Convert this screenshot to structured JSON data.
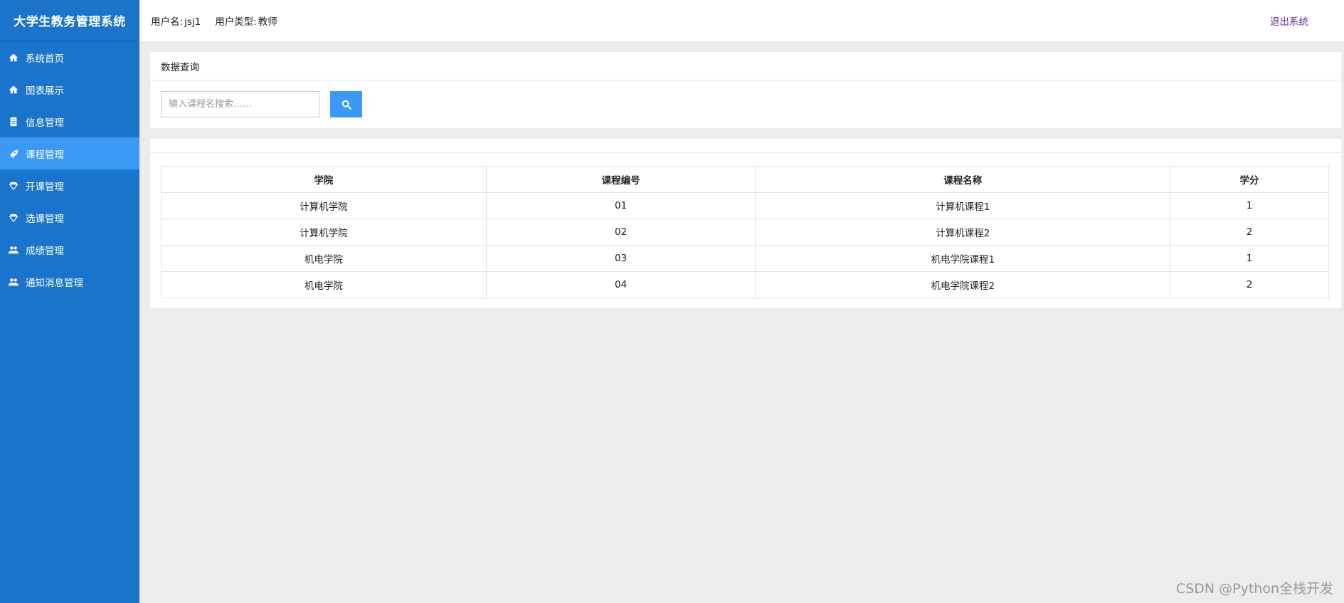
{
  "app": {
    "title": "大学生教务管理系统"
  },
  "sidebar": {
    "items": [
      {
        "label": "系统首页",
        "icon": "home-icon"
      },
      {
        "label": "图表展示",
        "icon": "home-icon"
      },
      {
        "label": "信息管理",
        "icon": "document-icon"
      },
      {
        "label": "课程管理",
        "icon": "rocket-icon",
        "active": true
      },
      {
        "label": "开课管理",
        "icon": "diamond-icon"
      },
      {
        "label": "选课管理",
        "icon": "diamond-icon"
      },
      {
        "label": "成绩管理",
        "icon": "users-icon"
      },
      {
        "label": "通知消息管理",
        "icon": "users-icon"
      }
    ]
  },
  "header": {
    "username_label": "用户名:",
    "username": "jsj1",
    "usertype_label": "用户类型:",
    "usertype": "教师",
    "logout_label": "退出系统"
  },
  "search": {
    "panel_title": "数据查询",
    "placeholder": "输入课程名搜索……",
    "value": ""
  },
  "table": {
    "columns": [
      "学院",
      "课程编号",
      "课程名称",
      "学分"
    ],
    "rows": [
      [
        "计算机学院",
        "01",
        "计算机课程1",
        "1"
      ],
      [
        "计算机学院",
        "02",
        "计算机课程2",
        "2"
      ],
      [
        "机电学院",
        "03",
        "机电学院课程1",
        "1"
      ],
      [
        "机电学院",
        "04",
        "机电学院课程2",
        "2"
      ]
    ]
  },
  "watermark": "CSDN @Python全栈开发",
  "colors": {
    "sidebar_bg": "#1a74cb",
    "active_item": "#3a9af6",
    "button": "#3a9af6",
    "logout": "#6a2a8a",
    "page_bg": "#ececec"
  }
}
